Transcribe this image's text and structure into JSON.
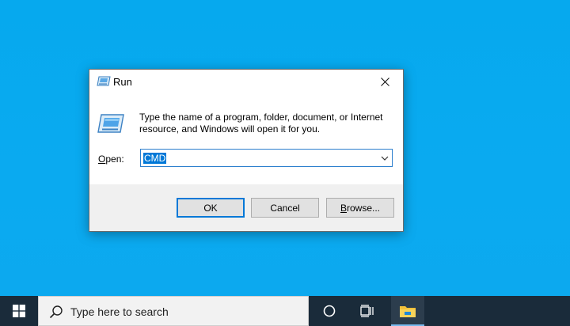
{
  "dialog": {
    "title": "Run",
    "description": "Type the name of a program, folder, document, or Internet resource, and Windows will open it for you.",
    "open_label_prefix": "",
    "open_label_underlined": "O",
    "open_label_rest": "pen:",
    "open_value": "CMD",
    "buttons": {
      "ok": "OK",
      "cancel": "Cancel",
      "browse_underlined": "B",
      "browse_rest": "rowse..."
    }
  },
  "taskbar": {
    "search_placeholder": "Type here to search",
    "icons": [
      "windows-start-icon",
      "search-icon",
      "cortana-icon",
      "task-view-icon",
      "file-explorer-icon"
    ]
  },
  "colors": {
    "desktop": "#0aaaf0",
    "taskbar": "#1a2b3a",
    "accent": "#0078d7"
  }
}
